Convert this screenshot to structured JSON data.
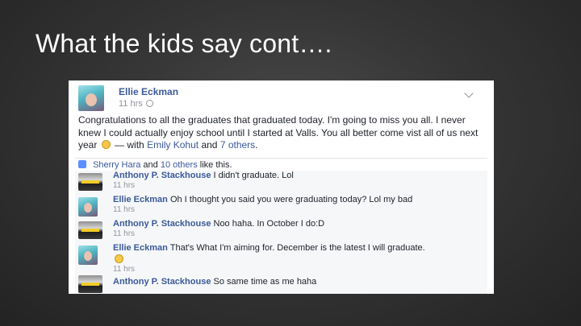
{
  "slide": {
    "title": "What the kids say cont…."
  },
  "post": {
    "author": "Ellie Eckman",
    "time": "11 hrs",
    "text_before_link": "Congratulations to all the graduates that graduated today. I'm going to miss you all. I never knew I could actually enjoy school until I started at Valls. You all better come vist all of us next year",
    "with_label": "— with",
    "tagged_person": "Emily Kohut",
    "and_label": "and",
    "others_link": "7 others",
    "period": ".",
    "likes": {
      "first_name": "Sherry Hara",
      "and_label": "and",
      "others_link": "10 others",
      "suffix": "like this."
    }
  },
  "comments": [
    {
      "author": "Anthony P. Stackhouse",
      "text": "I didn't graduate. Lol",
      "time": "11 hrs",
      "avatar": "car"
    },
    {
      "author": "Ellie Eckman",
      "text": "Oh I thought you said you were graduating today? Lol my bad",
      "time": "11 hrs",
      "avatar": "girl"
    },
    {
      "author": "Anthony P. Stackhouse",
      "text": "Noo haha. In October I do:D",
      "time": "11 hrs",
      "avatar": "car"
    },
    {
      "author": "Ellie Eckman",
      "text": "That's What I'm aiming for. December is the latest I will graduate.",
      "time": "11 hrs",
      "avatar": "girl"
    },
    {
      "author": "Anthony P. Stackhouse",
      "text": "So same time as me haha",
      "time": "",
      "avatar": "car"
    }
  ],
  "icons": {
    "like": "like-icon",
    "smiley": "smiley-icon",
    "globe": "globe-icon",
    "menu": "chevron-down-icon"
  },
  "colors": {
    "link": "#3b5998",
    "meta": "#90949c",
    "background": "#353535"
  }
}
